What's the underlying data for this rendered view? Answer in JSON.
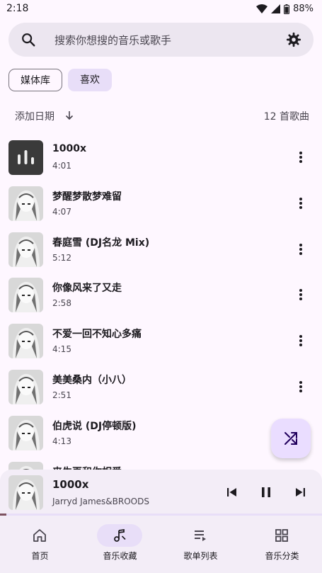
{
  "status": {
    "time": "2:18",
    "battery": "88%"
  },
  "search": {
    "placeholder": "搜索你想搜的音乐或歌手"
  },
  "filters": {
    "library": "媒体库",
    "favorites": "喜欢"
  },
  "sort": {
    "label": "添加日期",
    "count": "12 首歌曲"
  },
  "songs": [
    {
      "title": "1000x",
      "duration": "4:01"
    },
    {
      "title": "梦醒梦散梦难留",
      "duration": "4:07"
    },
    {
      "title": "春庭雪 (DJ名龙 Mix)",
      "duration": "5:12"
    },
    {
      "title": "你像风来了又走",
      "duration": "2:58"
    },
    {
      "title": "不爱一回不知心多痛",
      "duration": "4:15"
    },
    {
      "title": "美美桑内（小八）",
      "duration": "2:51"
    },
    {
      "title": "伯虎说 (DJ停顿版)",
      "duration": "4:13"
    },
    {
      "title": "来生再和你相爱",
      "duration": ""
    }
  ],
  "now_playing": {
    "title": "1000x",
    "artist": "Jarryd James&BROODS",
    "progress": 0.02
  },
  "nav": {
    "home": "首页",
    "favorites": "音乐收藏",
    "playlists": "歌单列表",
    "categories": "音乐分类"
  },
  "colors": {
    "background": "#FEF7FF",
    "accent": "#E8DEF8",
    "fab": "#EADDFF",
    "progress": "#7D5260"
  }
}
